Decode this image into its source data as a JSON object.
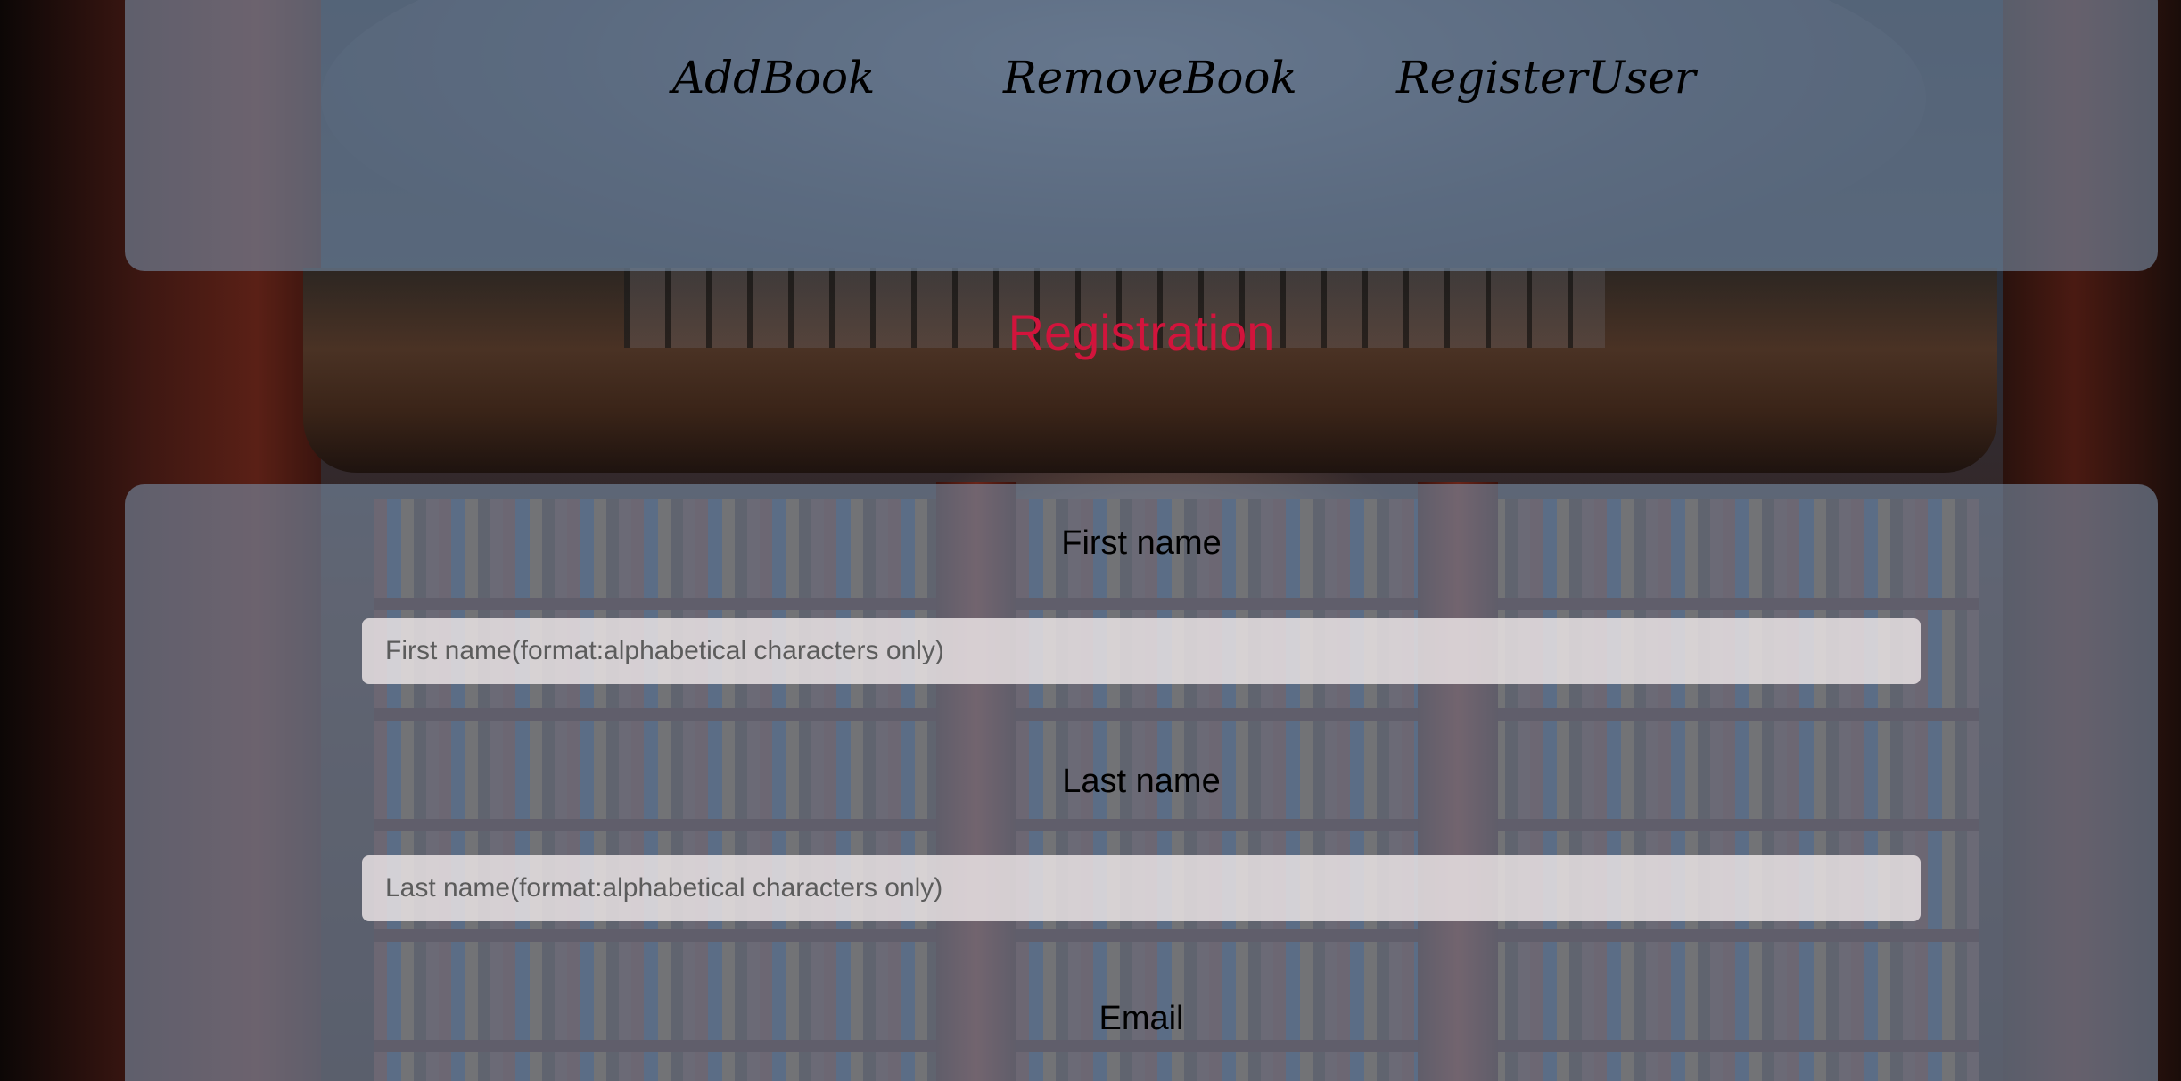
{
  "nav": {
    "items": [
      {
        "label": "AddBook"
      },
      {
        "label": "RemoveBook"
      },
      {
        "label": "RegisterUser"
      }
    ]
  },
  "page": {
    "title": "Registration",
    "title_color": "#d2143c"
  },
  "form": {
    "first_name": {
      "label": "First name",
      "placeholder": "First name(format:alphabetical characters only)",
      "value": ""
    },
    "last_name": {
      "label": "Last name",
      "placeholder": "Last name(format:alphabetical characters only)",
      "value": ""
    },
    "email": {
      "label": "Email"
    }
  }
}
